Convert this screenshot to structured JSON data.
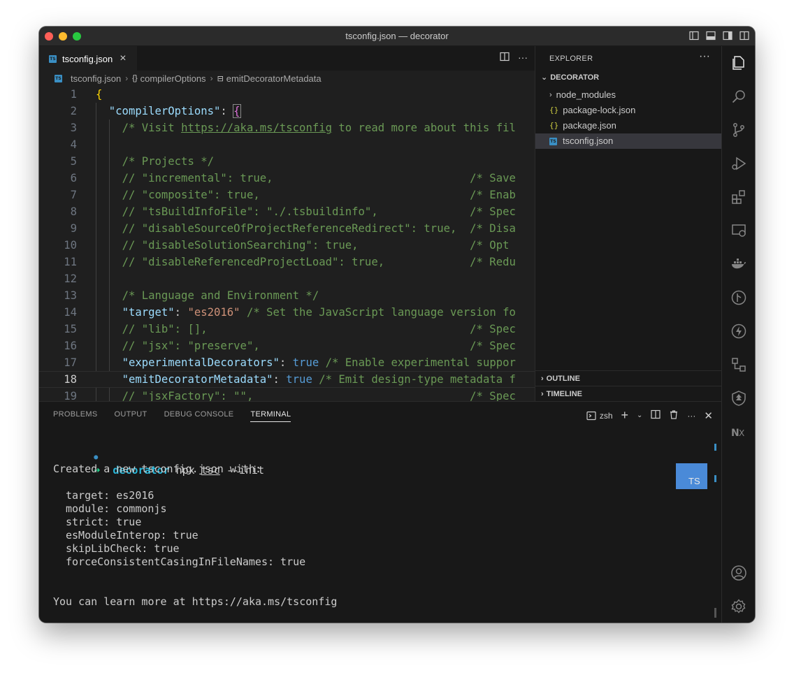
{
  "window": {
    "title": "tsconfig.json — decorator"
  },
  "editor": {
    "tab": {
      "label": "tsconfig.json",
      "icon": "ts-file-icon",
      "close": "×"
    },
    "tab_actions": {
      "split": "split-editor-icon",
      "more": "···"
    },
    "breadcrumb": [
      "tsconfig.json",
      "compilerOptions",
      "emitDecoratorMetadata"
    ],
    "lines": [
      {
        "n": "1",
        "segs": [
          {
            "t": "{",
            "c": "c-brace"
          }
        ]
      },
      {
        "n": "2",
        "segs": [
          {
            "t": "  "
          },
          {
            "t": "\"compilerOptions\"",
            "c": "c-key"
          },
          {
            "t": ": "
          },
          {
            "t": "{",
            "c": "c-brace2"
          }
        ]
      },
      {
        "n": "3",
        "segs": [
          {
            "t": "    "
          },
          {
            "t": "/* Visit ",
            "c": "c-comment"
          },
          {
            "t": "https://aka.ms/tsconfig",
            "c": "c-link"
          },
          {
            "t": " to read more about this fil",
            "c": "c-comment"
          }
        ]
      },
      {
        "n": "4",
        "segs": []
      },
      {
        "n": "5",
        "segs": [
          {
            "t": "    "
          },
          {
            "t": "/* Projects */",
            "c": "c-comment"
          }
        ]
      },
      {
        "n": "6",
        "segs": [
          {
            "t": "    "
          },
          {
            "t": "// \"incremental\": true,                              /* Save",
            "c": "c-comment"
          }
        ]
      },
      {
        "n": "7",
        "segs": [
          {
            "t": "    "
          },
          {
            "t": "// \"composite\": true,                                /* Enab",
            "c": "c-comment"
          }
        ]
      },
      {
        "n": "8",
        "segs": [
          {
            "t": "    "
          },
          {
            "t": "// \"tsBuildInfoFile\": \"./.tsbuildinfo\",              /* Spec",
            "c": "c-comment"
          }
        ]
      },
      {
        "n": "9",
        "segs": [
          {
            "t": "    "
          },
          {
            "t": "// \"disableSourceOfProjectReferenceRedirect\": true,  /* Disa",
            "c": "c-comment"
          }
        ]
      },
      {
        "n": "10",
        "segs": [
          {
            "t": "    "
          },
          {
            "t": "// \"disableSolutionSearching\": true,                 /* Opt ",
            "c": "c-comment"
          }
        ]
      },
      {
        "n": "11",
        "segs": [
          {
            "t": "    "
          },
          {
            "t": "// \"disableReferencedProjectLoad\": true,             /* Redu",
            "c": "c-comment"
          }
        ]
      },
      {
        "n": "12",
        "segs": []
      },
      {
        "n": "13",
        "segs": [
          {
            "t": "    "
          },
          {
            "t": "/* Language and Environment */",
            "c": "c-comment"
          }
        ]
      },
      {
        "n": "14",
        "segs": [
          {
            "t": "    "
          },
          {
            "t": "\"target\"",
            "c": "c-key"
          },
          {
            "t": ": "
          },
          {
            "t": "\"es2016\"",
            "c": "c-str"
          },
          {
            "t": " "
          },
          {
            "t": "/* Set the JavaScript language version fo",
            "c": "c-comment"
          }
        ]
      },
      {
        "n": "15",
        "segs": [
          {
            "t": "    "
          },
          {
            "t": "// \"lib\": [],                                        /* Spec",
            "c": "c-comment"
          }
        ]
      },
      {
        "n": "16",
        "segs": [
          {
            "t": "    "
          },
          {
            "t": "// \"jsx\": \"preserve\",                                /* Spec",
            "c": "c-comment"
          }
        ]
      },
      {
        "n": "17",
        "segs": [
          {
            "t": "    "
          },
          {
            "t": "\"experimentalDecorators\"",
            "c": "c-key"
          },
          {
            "t": ": "
          },
          {
            "t": "true",
            "c": "c-bool"
          },
          {
            "t": " "
          },
          {
            "t": "/* Enable experimental suppor",
            "c": "c-comment"
          }
        ]
      },
      {
        "n": "18",
        "segs": [
          {
            "t": "    "
          },
          {
            "t": "\"emitDecoratorMetadata\"",
            "c": "c-key"
          },
          {
            "t": ": "
          },
          {
            "t": "true",
            "c": "c-bool"
          },
          {
            "t": " "
          },
          {
            "t": "/* Emit design-type metadata f",
            "c": "c-comment"
          }
        ],
        "current": true
      },
      {
        "n": "19",
        "segs": [
          {
            "t": "    "
          },
          {
            "t": "// \"jsxFactory\": \"\",                                 /* Spec",
            "c": "c-comment"
          }
        ]
      }
    ]
  },
  "explorer": {
    "header": "EXPLORER",
    "more": "···",
    "section": "DECORATOR",
    "items": [
      {
        "label": "node_modules",
        "kind": "folder",
        "icon": "chevron-right-icon"
      },
      {
        "label": "package-lock.json",
        "kind": "json",
        "icon": "json-file-icon"
      },
      {
        "label": "package.json",
        "kind": "json",
        "icon": "json-file-icon"
      },
      {
        "label": "tsconfig.json",
        "kind": "ts",
        "icon": "ts-file-icon",
        "selected": true
      }
    ],
    "outline": "OUTLINE",
    "timeline": "TIMELINE"
  },
  "activity": [
    "explorer-icon",
    "search-icon",
    "source-control-icon",
    "run-debug-icon",
    "extensions-icon",
    "remote-explorer-icon",
    "docker-icon",
    "git-graph-icon",
    "thunder-client-icon",
    "flow-icon",
    "tree-icon",
    "nx-icon",
    "account-icon",
    "settings-gear-icon"
  ],
  "panel": {
    "tabs": [
      "PROBLEMS",
      "OUTPUT",
      "DEBUG CONSOLE",
      "TERMINAL"
    ],
    "active_tab": "TERMINAL",
    "shell": "zsh",
    "terminal": {
      "prompt_arrow": "➜",
      "dir": "decorator",
      "command_prefix": "npx ",
      "command_tsc": "tsc",
      "command_suffix": " --init",
      "created": "Created a new tsconfig.json with:",
      "options": [
        "target: es2016",
        "module: commonjs",
        "strict: true",
        "esModuleInterop: true",
        "skipLibCheck: true",
        "forceConsistentCasingInFileNames: true"
      ],
      "learn_more": "You can learn more at https://aka.ms/tsconfig"
    },
    "badge": "TS"
  }
}
